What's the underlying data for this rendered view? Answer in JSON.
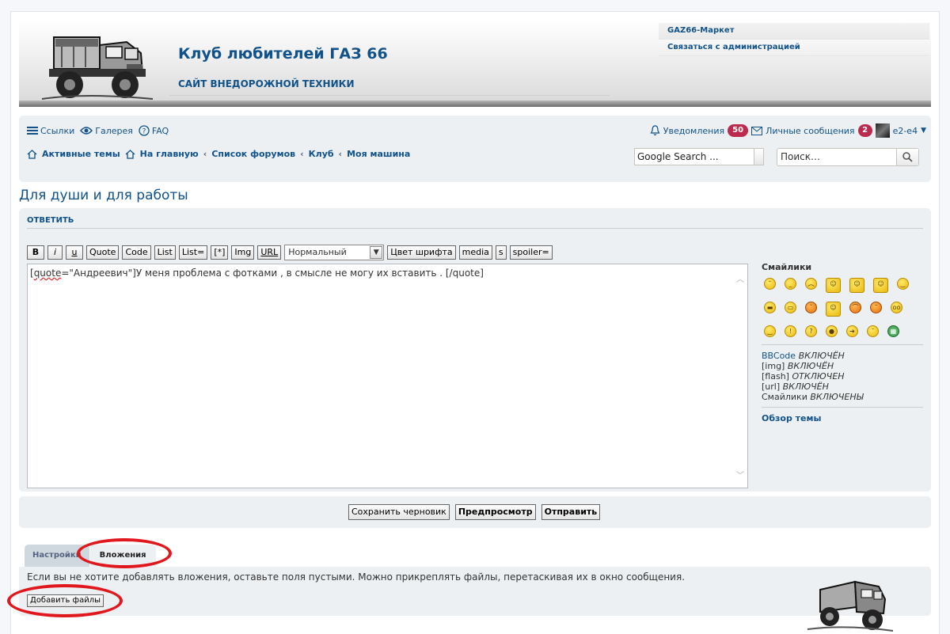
{
  "header": {
    "site_title": "Клуб любителей ГАЗ 66",
    "site_desc": "САЙТ ВНЕДОРОЖНОЙ ТЕХНИКИ",
    "links": [
      "GAZ66-Маркет",
      "Связаться с администрацией"
    ]
  },
  "nav": {
    "links": "Ссылки",
    "gallery": "Галерея",
    "faq": "FAQ",
    "notifications": "Уведомления",
    "notifications_count": "50",
    "messages": "Личные сообщения",
    "messages_count": "2",
    "username": "e2-e4"
  },
  "breadcrumbs": {
    "active": "Активные темы",
    "home": "На главную",
    "forums": "Список форумов",
    "club": "Клуб",
    "car": "Моя машина"
  },
  "search": {
    "google_value": "Google Search ...",
    "placeholder": "Поиск…"
  },
  "topic": {
    "title": "Для души и для работы"
  },
  "reply": {
    "panel_title": "ОТВЕТИТЬ",
    "toolbar": [
      "B",
      "i",
      "u",
      "Quote",
      "Code",
      "List",
      "List=",
      "[*]",
      "Img",
      "URL"
    ],
    "font_size": "Нормальный",
    "toolbar2": [
      "Цвет шрифта",
      "media",
      "s",
      "spoiler="
    ],
    "message_pre": "[",
    "message_word": "quote",
    "message_post": "=\"Андреевич\"]У меня проблема с фотками , в смысле не могу их вставить . [/quote]"
  },
  "sidebar": {
    "smileys_title": "Смайлики",
    "bbcode_label": "BBCode",
    "bbcode_state": "ВКЛЮЧЁН",
    "img_label": "[img]",
    "img_state": "ВКЛЮЧЁН",
    "flash_label": "[flash]",
    "flash_state": "ОТКЛЮЧЕН",
    "url_label": "[url]",
    "url_state": "ВКЛЮЧЁН",
    "smileys_label": "Смайлики",
    "smileys_state": "ВКЛЮЧЕНЫ",
    "overview": "Обзор темы"
  },
  "submit": {
    "draft": "Сохранить черновик",
    "preview": "Предпросмотр",
    "send": "Отправить"
  },
  "tabs": {
    "settings": "Настройки",
    "attachments": "Вложения"
  },
  "attachments": {
    "hint": "Если вы не хотите добавлять вложения, оставьте поля пустыми. Можно прикреплять файлы, перетаскивая их в окно сообщения.",
    "add_button": "Добавить файлы"
  },
  "colors": {
    "link": "#105289",
    "panel": "#ecf0f3",
    "badge": "#bc2a4d",
    "annotation": "#e0171d"
  }
}
